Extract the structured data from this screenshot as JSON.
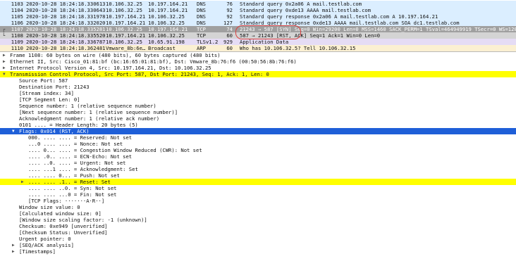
{
  "packets": [
    {
      "no": "1103",
      "time": "2020-10-28 18:24:18.330613",
      "src": "10.106.32.25",
      "dst": "10.197.164.21",
      "proto": "DNS",
      "len": "76",
      "info": "Standard query 0x2a06 A mail.testlab.com",
      "bg": "#dbeeff",
      "fg": "#111111",
      "mark": ""
    },
    {
      "no": "1104",
      "time": "2020-10-28 18:24:18.330643",
      "src": "10.106.32.25",
      "dst": "10.197.164.21",
      "proto": "DNS",
      "len": "92",
      "info": "Standard query 0xde13 AAAA mail.testlab.com",
      "bg": "#dbeeff",
      "fg": "#111111",
      "mark": ""
    },
    {
      "no": "1105",
      "time": "2020-10-28 18:24:18.331978",
      "src": "10.197.164.21",
      "dst": "10.106.32.25",
      "proto": "DNS",
      "len": "92",
      "info": "Standard query response 0x2a06 A mail.testlab.com A 10.197.164.21",
      "bg": "#dbeeff",
      "fg": "#111111",
      "mark": ""
    },
    {
      "no": "1106",
      "time": "2020-10-28 18:24:18.332020",
      "src": "10.197.164.21",
      "dst": "10.106.32.25",
      "proto": "DNS",
      "len": "127",
      "info": "Standard query response 0xde13 AAAA mail.testlab.com SOA dc1.testlab.com",
      "bg": "#dbeeff",
      "fg": "#111111",
      "mark": ""
    },
    {
      "no": "1107",
      "time": "2020-10-28 18:24:18.335281",
      "src": "10.106.32.25",
      "dst": "10.197.164.21",
      "proto": "TCP",
      "len": "74",
      "info": "21243 → 587 [SYN] Seq=0 Win=29200 Len=0 MSS=1460 SACK_PERM=1 TSval=464949919 TSecr=0 WS=128",
      "bg": "#a0a0a0",
      "fg": "#ffffff",
      "mark": "┌"
    },
    {
      "no": "1108",
      "time": "2020-10-28 18:24:18.335520",
      "src": "10.197.164.21",
      "dst": "10.106.32.25",
      "proto": "TCP",
      "len": "60",
      "info": "587 → 21243 [RST, ACK] Seq=1 Ack=1 Win=0 Len=0",
      "bg": "#d4d4d4",
      "fg": "#111111",
      "mark": "└"
    },
    {
      "no": "1109",
      "time": "2020-10-28 18:24:18.336787",
      "src": "10.106.32.25",
      "dst": "10.65.91.198",
      "proto": "TLSv1.2",
      "len": "929",
      "info": "Application Data",
      "bg": "#e5dcf5",
      "fg": "#111111",
      "mark": ""
    },
    {
      "no": "1110",
      "time": "2020-10-28 18:24:18.362481",
      "src": "Vmware_8b:6e…",
      "dst": "Broadcast",
      "proto": "ARP",
      "len": "60",
      "info": "Who has 10.106.32.5? Tell 10.106.32.15",
      "bg": "#fbf0d2",
      "fg": "#111111",
      "mark": ""
    }
  ],
  "details": [
    {
      "indent": 0,
      "expander": "closed",
      "text": "Frame 1108: 60 bytes on wire (480 bits), 60 bytes captured (480 bits)",
      "style": "normal"
    },
    {
      "indent": 0,
      "expander": "closed",
      "text": "Ethernet II, Src: Cisco_01:81:bf (bc:16:65:01:81:bf), Dst: Vmware_8b:76:f6 (00:50:56:8b:76:f6)",
      "style": "normal"
    },
    {
      "indent": 0,
      "expander": "closed",
      "text": "Internet Protocol Version 4, Src: 10.197.164.21, Dst: 10.106.32.25",
      "style": "normal"
    },
    {
      "indent": 0,
      "expander": "open",
      "text": "Transmission Control Protocol, Src Port: 587, Dst Port: 21243, Seq: 1, Ack: 1, Len: 0",
      "style": "yellow"
    },
    {
      "indent": 1,
      "expander": "",
      "text": "Source Port: 587",
      "style": "normal"
    },
    {
      "indent": 1,
      "expander": "",
      "text": "Destination Port: 21243",
      "style": "normal"
    },
    {
      "indent": 1,
      "expander": "",
      "text": "[Stream index: 34]",
      "style": "normal"
    },
    {
      "indent": 1,
      "expander": "",
      "text": "[TCP Segment Len: 0]",
      "style": "normal"
    },
    {
      "indent": 1,
      "expander": "",
      "text": "Sequence number: 1    (relative sequence number)",
      "style": "normal"
    },
    {
      "indent": 1,
      "expander": "",
      "text": "[Next sequence number: 1    (relative sequence number)]",
      "style": "normal"
    },
    {
      "indent": 1,
      "expander": "",
      "text": "Acknowledgment number: 1    (relative ack number)",
      "style": "normal"
    },
    {
      "indent": 1,
      "expander": "",
      "text": "0101 .... = Header Length: 20 bytes (5)",
      "style": "normal"
    },
    {
      "indent": 1,
      "expander": "open",
      "text": "Flags: 0x014 (RST, ACK)",
      "style": "selected"
    },
    {
      "indent": 2,
      "expander": "",
      "text": "000. .... .... = Reserved: Not set",
      "style": "normal"
    },
    {
      "indent": 2,
      "expander": "",
      "text": "...0 .... .... = Nonce: Not set",
      "style": "normal"
    },
    {
      "indent": 2,
      "expander": "",
      "text": ".... 0... .... = Congestion Window Reduced (CWR): Not set",
      "style": "normal"
    },
    {
      "indent": 2,
      "expander": "",
      "text": ".... .0.. .... = ECN-Echo: Not set",
      "style": "normal"
    },
    {
      "indent": 2,
      "expander": "",
      "text": ".... ..0. .... = Urgent: Not set",
      "style": "normal"
    },
    {
      "indent": 2,
      "expander": "",
      "text": ".... ...1 .... = Acknowledgment: Set",
      "style": "normal"
    },
    {
      "indent": 2,
      "expander": "",
      "text": ".... .... 0... = Push: Not set",
      "style": "normal"
    },
    {
      "indent": 2,
      "expander": "closed",
      "text": ".... .... .1.. = Reset: Set",
      "style": "yellow"
    },
    {
      "indent": 2,
      "expander": "",
      "text": ".... .... ..0. = Syn: Not set",
      "style": "normal"
    },
    {
      "indent": 2,
      "expander": "",
      "text": ".... .... ...0 = Fin: Not set",
      "style": "normal"
    },
    {
      "indent": 2,
      "expander": "",
      "text": "[TCP Flags: ·······A·R··]",
      "style": "normal"
    },
    {
      "indent": 1,
      "expander": "",
      "text": "Window size value: 0",
      "style": "normal"
    },
    {
      "indent": 1,
      "expander": "",
      "text": "[Calculated window size: 0]",
      "style": "normal"
    },
    {
      "indent": 1,
      "expander": "",
      "text": "[Window size scaling factor: -1 (unknown)]",
      "style": "normal"
    },
    {
      "indent": 1,
      "expander": "",
      "text": "Checksum: 0xe949 [unverified]",
      "style": "normal"
    },
    {
      "indent": 1,
      "expander": "",
      "text": "[Checksum Status: Unverified]",
      "style": "normal"
    },
    {
      "indent": 1,
      "expander": "",
      "text": "Urgent pointer: 0",
      "style": "normal"
    },
    {
      "indent": 1,
      "expander": "closed",
      "text": "[SEQ/ACK analysis]",
      "style": "normal"
    },
    {
      "indent": 1,
      "expander": "closed",
      "text": "[Timestamps]",
      "style": "normal"
    }
  ],
  "colors": {
    "yellow_highlight": "#ffff00",
    "selected_bg": "#1e5fd8",
    "selected_fg": "#ffffff",
    "conversation_marker": "#d94040"
  },
  "icons": {
    "expand_closed": "▶",
    "expand_open": "▼"
  }
}
